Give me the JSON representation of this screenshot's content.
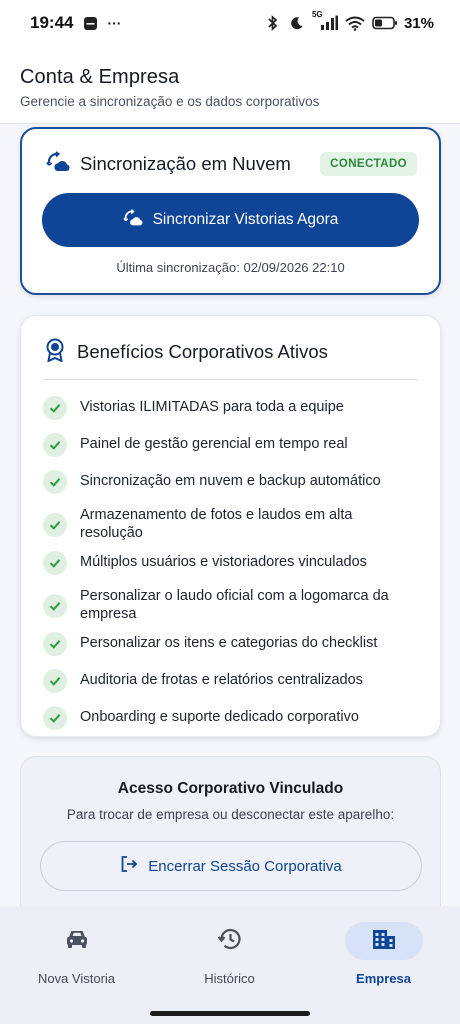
{
  "status_bar": {
    "time": "19:44",
    "dots": "···",
    "network": "5G",
    "battery": "31%"
  },
  "header": {
    "title": "Conta & Empresa",
    "subtitle": "Gerencie a sincronização e os dados corporativos"
  },
  "sync_card": {
    "title": "Sincronização em Nuvem",
    "badge": "CONECTADO",
    "button_label": "Sincronizar Vistorias Agora",
    "last_sync": "Última sincronização: 02/09/2026 22:10"
  },
  "benefits_card": {
    "title": "Benefícios Corporativos Ativos",
    "items": [
      "Vistorias ILIMITADAS para toda a equipe",
      "Painel de gestão gerencial em tempo real",
      "Sincronização em nuvem e backup automático",
      "Armazenamento de fotos e laudos em alta resolução",
      "Múltiplos usuários e vistoriadores vinculados",
      "Personalizar o laudo oficial com a logomarca da empresa",
      "Personalizar os itens e categorias do checklist",
      "Auditoria de frotas e relatórios centralizados",
      "Onboarding e suporte dedicado corporativo"
    ]
  },
  "corporate_card": {
    "title": "Acesso Corporativo Vinculado",
    "subtitle": "Para trocar de empresa ou desconectar este aparelho:",
    "logout_label": "Encerrar Sessão Corporativa"
  },
  "bottom_nav": {
    "items": [
      {
        "label": "Nova Vistoria",
        "icon": "car-icon"
      },
      {
        "label": "Histórico",
        "icon": "history-icon"
      },
      {
        "label": "Empresa",
        "icon": "building-icon"
      }
    ],
    "active": "Empresa"
  },
  "colors": {
    "primary": "#0f4597",
    "success_bg": "#e3f4e6",
    "success_text": "#2a8a3c"
  }
}
